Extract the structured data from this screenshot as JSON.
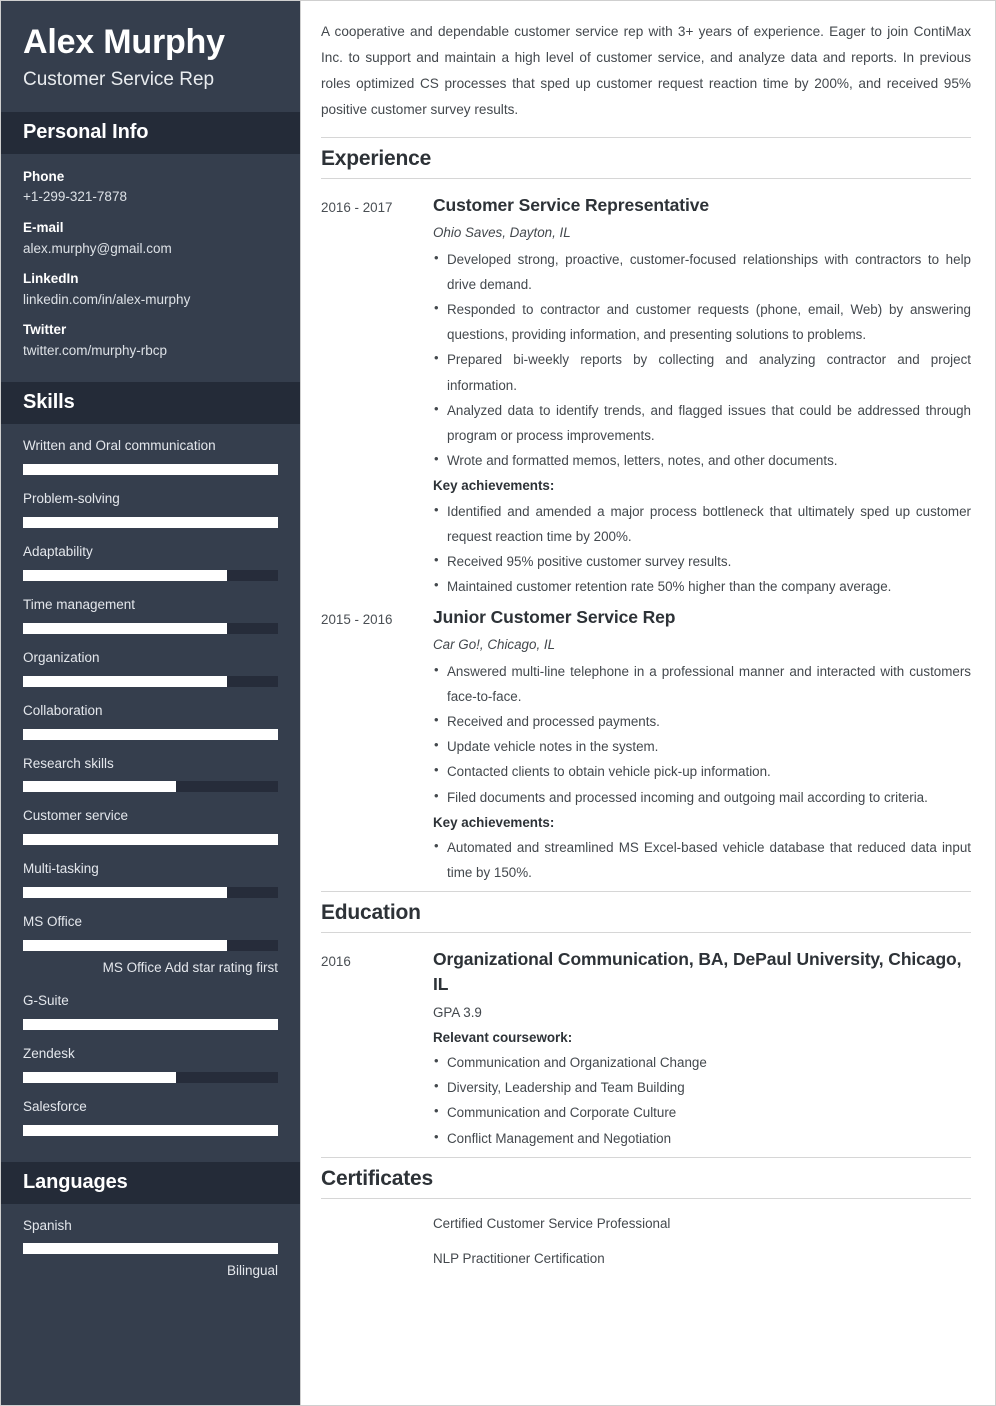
{
  "sidebar": {
    "name": "Alex Murphy",
    "job_title": "Customer Service Rep",
    "personal_info": {
      "heading": "Personal Info",
      "items": [
        {
          "label": "Phone",
          "value": "+1-299-321-7878"
        },
        {
          "label": "E-mail",
          "value": "alex.murphy@gmail.com"
        },
        {
          "label": "LinkedIn",
          "value": "linkedin.com/in/alex-murphy"
        },
        {
          "label": "Twitter",
          "value": "twitter.com/murphy-rbcp"
        }
      ]
    },
    "skills": {
      "heading": "Skills",
      "items": [
        {
          "name": "Written and Oral communication",
          "level": 100
        },
        {
          "name": "Problem-solving",
          "level": 100
        },
        {
          "name": "Adaptability",
          "level": 80
        },
        {
          "name": "Time management",
          "level": 80
        },
        {
          "name": "Organization",
          "level": 80
        },
        {
          "name": "Collaboration",
          "level": 100
        },
        {
          "name": "Research skills",
          "level": 60
        },
        {
          "name": "Customer service",
          "level": 100
        },
        {
          "name": "Multi-tasking",
          "level": 80
        },
        {
          "name": "MS Office",
          "level": 80,
          "note": "MS Office Add star rating first"
        },
        {
          "name": "G-Suite",
          "level": 100
        },
        {
          "name": "Zendesk",
          "level": 60
        },
        {
          "name": "Salesforce",
          "level": 100
        }
      ]
    },
    "languages": {
      "heading": "Languages",
      "items": [
        {
          "name": "Spanish",
          "level": 100,
          "note": "Bilingual"
        }
      ]
    }
  },
  "main": {
    "summary": "A cooperative and dependable customer service rep with 3+ years of experience. Eager to join ContiMax Inc. to support and maintain a high level of customer service, and analyze data and reports. In previous roles optimized CS processes that sped up customer request reaction time by 200%, and received 95% positive customer survey results.",
    "experience": {
      "heading": "Experience",
      "entries": [
        {
          "date": "2016 - 2017",
          "role": "Customer Service Representative",
          "org": "Ohio Saves, Dayton, IL",
          "bullets": [
            "Developed strong, proactive, customer-focused relationships with contractors to help drive demand.",
            "Responded to contractor and customer requests (phone, email, Web) by answering questions, providing information, and presenting solutions to problems.",
            "Prepared bi-weekly reports by collecting and analyzing contractor and project information.",
            "Analyzed data to identify trends, and flagged issues that could be addressed through program or process improvements.",
            "Wrote and formatted memos, letters, notes, and other documents."
          ],
          "achievements_label": "Key achievements:",
          "achievements": [
            "Identified and amended a major process bottleneck that ultimately sped up customer request reaction time by 200%.",
            "Received 95% positive customer survey results.",
            "Maintained customer retention rate 50% higher than the company average."
          ]
        },
        {
          "date": "2015 - 2016",
          "role": "Junior Customer Service Rep",
          "org": "Car Go!, Chicago, IL",
          "bullets": [
            "Answered multi-line telephone in a professional manner and interacted with customers face-to-face.",
            "Received and processed payments.",
            "Update vehicle notes in the system.",
            "Contacted clients to obtain vehicle pick-up information.",
            "Filed documents and processed incoming and outgoing mail according to criteria."
          ],
          "achievements_label": "Key achievements:",
          "achievements": [
            "Automated and streamlined MS Excel-based vehicle database that reduced data input time by 150%."
          ]
        }
      ]
    },
    "education": {
      "heading": "Education",
      "entries": [
        {
          "date": "2016",
          "degree": "Organizational Communication, BA, DePaul University, Chicago, IL",
          "gpa": "GPA 3.9",
          "coursework_label": "Relevant coursework:",
          "coursework": [
            "Communication and Organizational Change",
            "Diversity, Leadership and Team Building",
            "Communication and Corporate Culture",
            "Conflict Management and Negotiation"
          ]
        }
      ]
    },
    "certificates": {
      "heading": "Certificates",
      "items": [
        "Certified Customer Service Professional",
        "NLP Practitioner Certification"
      ]
    }
  }
}
